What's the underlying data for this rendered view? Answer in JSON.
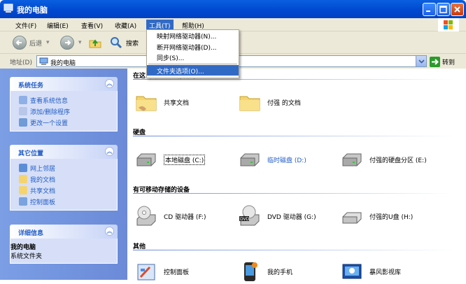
{
  "window": {
    "title": "我的电脑"
  },
  "menu": [
    "文件(F)",
    "编辑(E)",
    "查看(V)",
    "收藏(A)",
    "工具(T)",
    "帮助(H)"
  ],
  "tools_menu": {
    "items": [
      "映射网络驱动器(N)...",
      "断开网络驱动器(D)...",
      "同步(S)...",
      "文件夹选项(O)..."
    ]
  },
  "toolbar": {
    "back": "后退",
    "search": "搜索"
  },
  "address": {
    "label": "地址(D)",
    "value": "我的电脑",
    "go": "转到"
  },
  "left": {
    "system_tasks": {
      "title": "系统任务",
      "items": [
        "查看系统信息",
        "添加/删除程序",
        "更改一个设置"
      ]
    },
    "other_places": {
      "title": "其它位置",
      "items": [
        "网上邻居",
        "我的文档",
        "共享文档",
        "控制面板"
      ]
    },
    "details": {
      "title": "详细信息",
      "name": "我的电脑",
      "subtitle": "系统文件夹"
    }
  },
  "groups": {
    "files": {
      "title": "在这台计算机上存储的文件",
      "items": [
        "共享文档",
        "付强 的文档"
      ]
    },
    "hdd": {
      "title": "硬盘",
      "items": [
        "本地磁盘 (C:)",
        "临时磁盘 (D:)",
        "付强的硬盘分区 (E:)"
      ]
    },
    "removable": {
      "title": "有可移动存储的设备",
      "items": [
        "CD 驱动器 (F:)",
        "DVD 驱动器 (G:)",
        "付强的U盘 (H:)"
      ]
    },
    "other": {
      "title": "其他",
      "items": [
        "控制面板",
        "我的手机",
        "暴风影视库"
      ]
    }
  },
  "icons": [
    "folder-icon",
    "hard-drive-icon",
    "cd-drive-icon",
    "dvd-drive-icon",
    "usb-drive-icon",
    "control-panel-icon",
    "phone-icon",
    "media-library-icon"
  ],
  "colors": {
    "title_bar": "#0a5fe0",
    "task_pane": "#6b8ad8",
    "link": "#215dc6",
    "menu_highlight": "#316ac5"
  }
}
